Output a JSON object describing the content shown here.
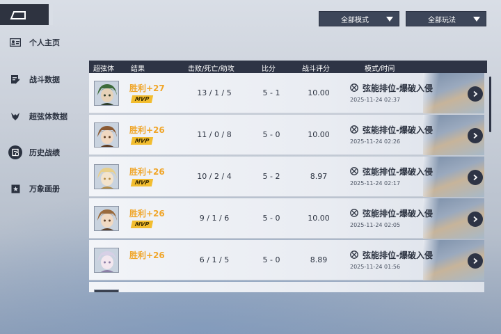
{
  "nav": {
    "back": "back"
  },
  "filters": {
    "mode": "全部模式",
    "play": "全部玩法"
  },
  "sidebar": {
    "items": [
      {
        "label": "个人主页",
        "icon": "id-card-icon"
      },
      {
        "label": "战斗数据",
        "icon": "notepad-icon"
      },
      {
        "label": "超弦体数据",
        "icon": "crest-icon"
      },
      {
        "label": "历史战绩",
        "icon": "history-icon",
        "active": true
      },
      {
        "label": "万象画册",
        "icon": "album-icon"
      }
    ]
  },
  "table": {
    "headers": {
      "character": "超弦体",
      "result": "结果",
      "kda": "击败/死亡/助攻",
      "score": "比分",
      "rating": "战斗评分",
      "mode_time": "模式/时间"
    },
    "rows": [
      {
        "result": "胜利+27",
        "mvp": "MVP",
        "kda": "13 / 1 / 5",
        "score": "5 - 1",
        "rating": "10.00",
        "mode": "弦能排位-爆破入侵",
        "time": "2025-11-24 02:37"
      },
      {
        "result": "胜利+26",
        "mvp": "MVP",
        "kda": "11 / 0 / 8",
        "score": "5 - 0",
        "rating": "10.00",
        "mode": "弦能排位-爆破入侵",
        "time": "2025-11-24 02:26"
      },
      {
        "result": "胜利+26",
        "mvp": "MVP",
        "kda": "10 / 2 / 4",
        "score": "5 - 2",
        "rating": "8.97",
        "mode": "弦能排位-爆破入侵",
        "time": "2025-11-24 02:17"
      },
      {
        "result": "胜利+26",
        "mvp": "MVP",
        "kda": "9 / 1 / 6",
        "score": "5 - 0",
        "rating": "10.00",
        "mode": "弦能排位-爆破入侵",
        "time": "2025-11-24 02:05"
      },
      {
        "result": "胜利+26",
        "mvp": "",
        "kda": "6 / 1 / 5",
        "score": "5 - 0",
        "rating": "8.89",
        "mode": "弦能排位-爆破入侵",
        "time": "2025-11-24 01:56"
      }
    ]
  },
  "colors": {
    "win": "#f0a62a",
    "mvp_bg": "#f2bd2f",
    "dark": "#2e3445"
  }
}
